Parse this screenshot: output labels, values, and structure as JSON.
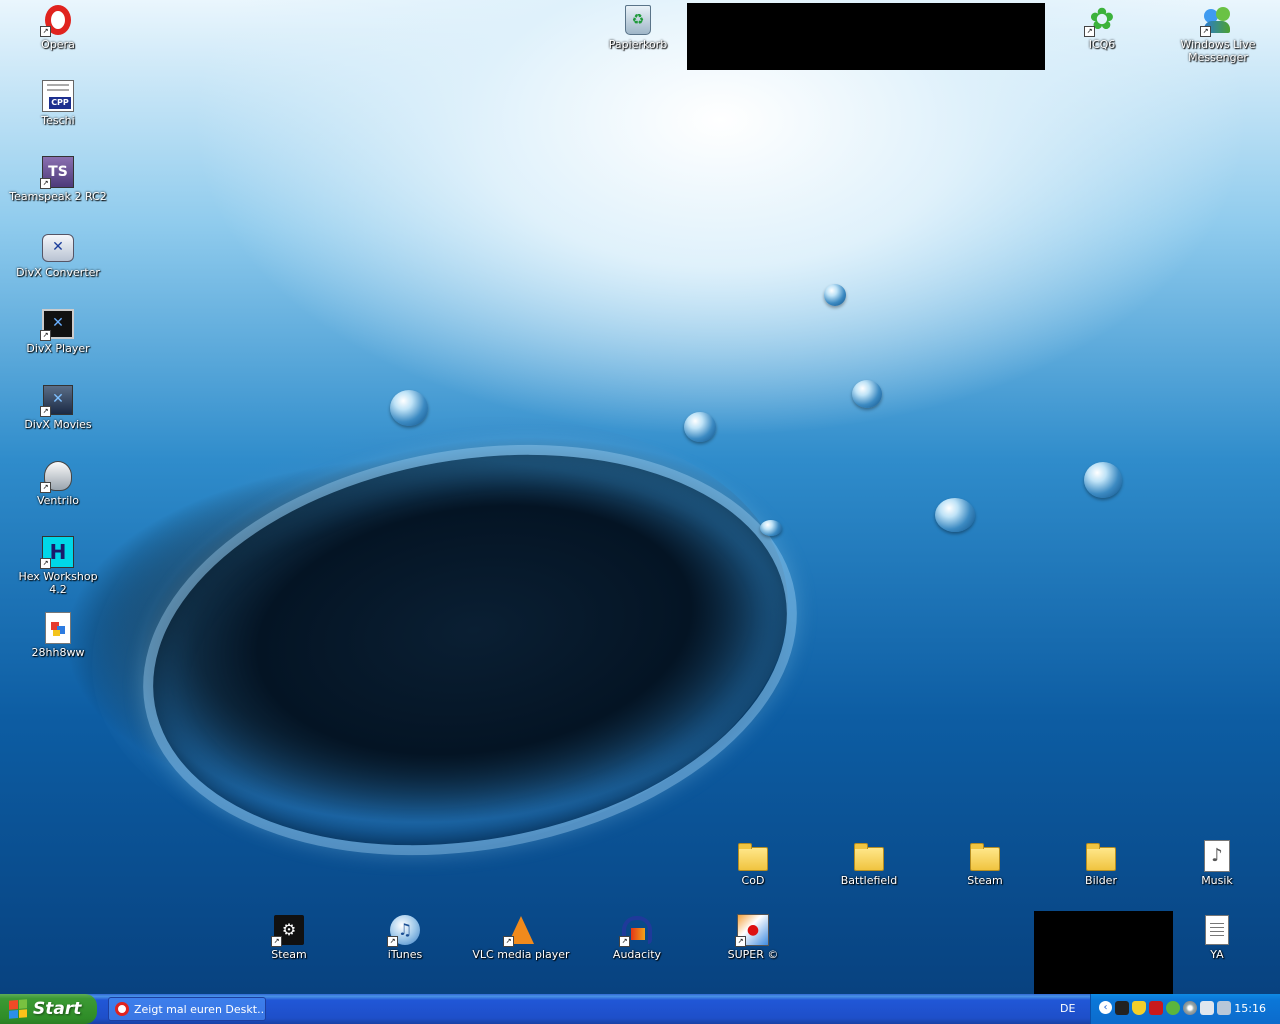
{
  "desktop": {
    "left_icons": [
      {
        "label": "Opera",
        "icon": "opera-icon"
      },
      {
        "label": "Teschi",
        "icon": "cpp-icon"
      },
      {
        "label": "Teamspeak 2 RC2",
        "icon": "teamspeak-icon"
      },
      {
        "label": "DivX Converter",
        "icon": "divx-converter-icon"
      },
      {
        "label": "DivX Player",
        "icon": "divx-player-icon"
      },
      {
        "label": "DivX Movies",
        "icon": "divx-movies-icon"
      },
      {
        "label": "Ventrilo",
        "icon": "ventrilo-icon"
      },
      {
        "label": "Hex Workshop 4.2",
        "icon": "hex-workshop-icon"
      },
      {
        "label": "28hh8ww",
        "icon": "image-file-icon"
      }
    ],
    "top_icons": [
      {
        "label": "Papierkorb",
        "icon": "recycle-bin-icon"
      },
      {
        "label": "ICQ6",
        "icon": "icq-icon"
      },
      {
        "label": "Windows Live Messenger",
        "icon": "messenger-icon"
      }
    ],
    "folder_icons": [
      {
        "label": "CoD",
        "icon": "folder-icon"
      },
      {
        "label": "Battlefield",
        "icon": "folder-icon"
      },
      {
        "label": "Steam",
        "icon": "folder-icon"
      },
      {
        "label": "Bilder",
        "icon": "folder-icon"
      },
      {
        "label": "Musik",
        "icon": "music-file-icon"
      }
    ],
    "bottom_icons": [
      {
        "label": "Steam",
        "icon": "steam-icon"
      },
      {
        "label": "iTunes",
        "icon": "itunes-icon"
      },
      {
        "label": "VLC media player",
        "icon": "vlc-icon"
      },
      {
        "label": "Audacity",
        "icon": "audacity-icon"
      },
      {
        "label": "SUPER ©",
        "icon": "super-icon"
      },
      {
        "label": "YA",
        "icon": "text-file-icon"
      }
    ]
  },
  "taskbar": {
    "start_label": "Start",
    "task_items": [
      {
        "label": "Zeigt mal euren Deskt...",
        "icon": "opera-icon"
      }
    ],
    "language": "DE",
    "tray_icons": [
      "collapse-arrow-icon",
      "steam-tray-icon",
      "security-shield-icon",
      "kaspersky-icon",
      "messenger-tray-icon",
      "cd-icon",
      "network-icon",
      "monitor-icon"
    ],
    "clock": "15:16"
  },
  "colors": {
    "taskbar_blue": "#2157d7",
    "start_green": "#3c9a34",
    "tray_blue": "#0b77d8"
  }
}
